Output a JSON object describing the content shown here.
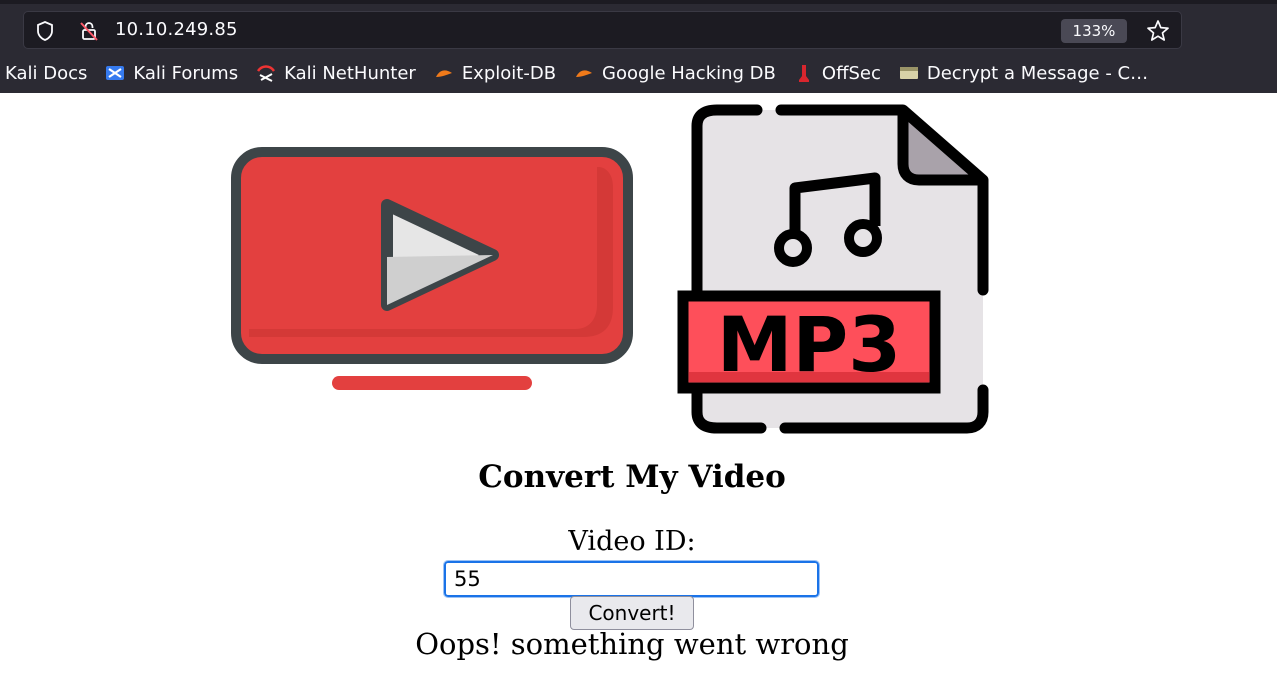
{
  "browser": {
    "url": "10.10.249.85",
    "zoom": "133%",
    "icons": [
      "shield-icon",
      "insecure-lock-icon",
      "star-icon"
    ],
    "bookmarks": [
      {
        "label": "Kali Docs",
        "icon": "none"
      },
      {
        "label": "Kali Forums",
        "icon": "kali-forums-icon"
      },
      {
        "label": "Kali NetHunter",
        "icon": "kali-nethunter-icon"
      },
      {
        "label": "Exploit-DB",
        "icon": "exploit-db-icon"
      },
      {
        "label": "Google Hacking DB",
        "icon": "ghdb-icon"
      },
      {
        "label": "OffSec",
        "icon": "offsec-icon"
      },
      {
        "label": "Decrypt a Message - C…",
        "icon": "decrypt-icon"
      }
    ]
  },
  "page": {
    "title": "Convert My Video",
    "form": {
      "label": "Video ID:",
      "input_value": "55",
      "button_label": "Convert!"
    },
    "error": "Oops! something went wrong",
    "logos": {
      "video_logo": "youtube-play-icon",
      "mp3_logo": "mp3-file-icon",
      "mp3_text": "MP3"
    }
  },
  "colors": {
    "chrome_bg": "#2b2a33",
    "urlbar_bg": "#1c1b22",
    "logo_red": "#e3403f",
    "logo_outline": "#3d4548",
    "input_focus": "#1a73e8"
  }
}
